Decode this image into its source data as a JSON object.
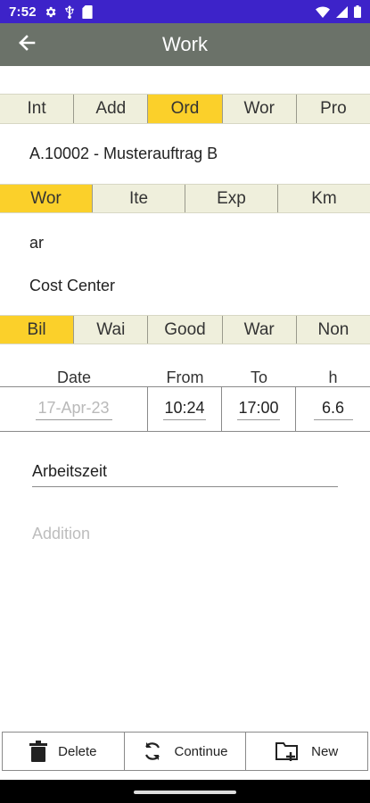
{
  "status_bar": {
    "time": "7:52",
    "left_icons": [
      "settings-icon",
      "usb-icon",
      "sd-card-icon"
    ],
    "right_icons": [
      "wifi-icon",
      "signal-icon",
      "battery-icon"
    ],
    "color": "#3d23c9"
  },
  "app_bar": {
    "title": "Work",
    "back_icon": "arrow-back-icon",
    "color": "#6b7269"
  },
  "tabs_primary": {
    "items": [
      "Int",
      "Add",
      "Ord",
      "Wor",
      "Pro"
    ],
    "active_index": 2
  },
  "order_line": "A.10002 - Musterauftrag B",
  "tabs_secondary": {
    "items": [
      "Wor",
      "Ite",
      "Exp",
      "Km"
    ],
    "active_index": 0
  },
  "activity_line": "ar",
  "cost_center_label": "Cost Center",
  "tabs_billing": {
    "items": [
      "Bil",
      "Wai",
      "Good",
      "War",
      "Non"
    ],
    "active_index": 0
  },
  "time_table": {
    "headers": {
      "date": "Date",
      "from": "From",
      "to": "To",
      "hours": "h"
    },
    "values": {
      "date": "17-Apr-23",
      "from": "10:24",
      "to": "17:00",
      "hours": "6.6"
    }
  },
  "description": {
    "value": "Arbeitszeit"
  },
  "addition": {
    "placeholder": "Addition"
  },
  "bottom_actions": {
    "delete": {
      "label": "Delete",
      "icon": "trash-icon"
    },
    "continue": {
      "label": "Continue",
      "icon": "refresh-icon"
    },
    "new": {
      "label": "New",
      "icon": "new-folder-icon"
    }
  },
  "colors": {
    "tab_background": "#efefdc",
    "tab_active": "#fbd02a"
  }
}
